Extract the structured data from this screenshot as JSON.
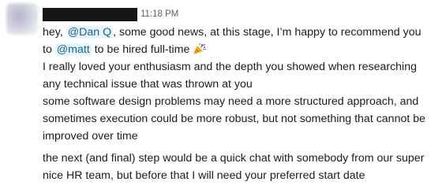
{
  "message": {
    "timestamp": "11:18 PM",
    "line1": {
      "before": "hey, ",
      "mention1": "@Dan Q",
      "after": ", some good news, at this stage, I’m happy to recommend you"
    },
    "line2": {
      "before": "to ",
      "mention2": "@matt",
      "after": " to be hired full-time"
    },
    "emoji_icon": "party-popper-icon",
    "p2": "I really loved your enthusiasm and the depth you showed when researching any technical issue that was thrown at you",
    "p3": "some software design problems may need a more structured approach, and sometimes execution could be more robust, but not something that cannot be improved over time",
    "p4": "the next (and final) step would be a quick chat with somebody from our super nice HR team, but before that I will need your preferred start date"
  },
  "colors": {
    "mention_bg": "#e8f5fa",
    "mention_text": "#1264a3",
    "timestamp": "#616061"
  }
}
